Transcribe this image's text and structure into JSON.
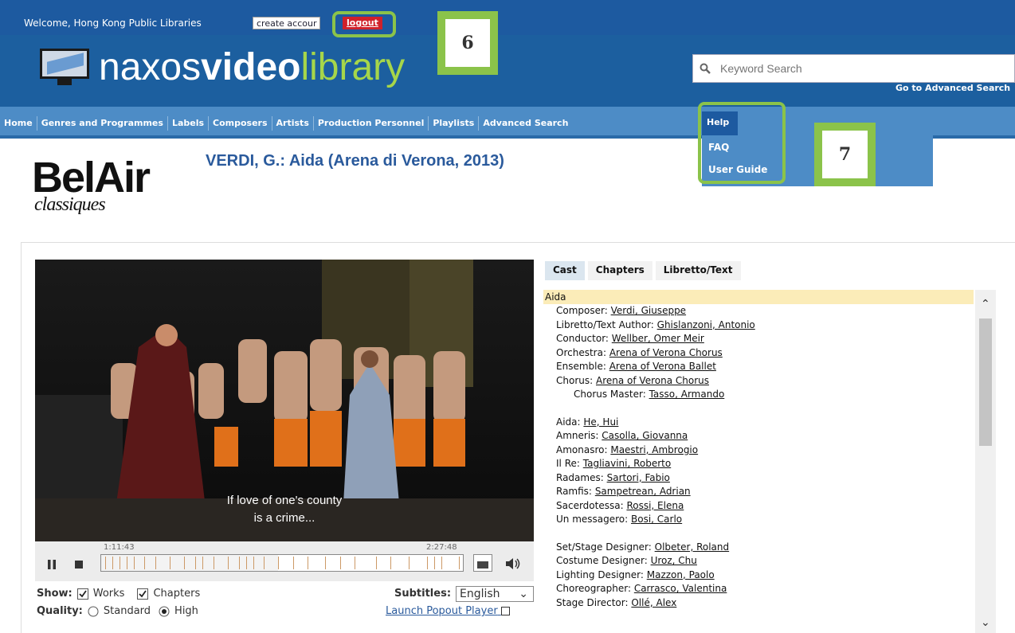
{
  "topbar": {
    "welcome": "Welcome, Hong Kong Public Libraries",
    "create_account": "create accour",
    "logout": "logout"
  },
  "header": {
    "logo_word1": "naxos",
    "logo_word2": "video",
    "logo_word3": "library",
    "search_placeholder": "Keyword Search",
    "advanced_link": "Go to Advanced Search"
  },
  "nav": {
    "items": [
      "Home",
      "Genres and Programmes",
      "Labels",
      "Composers",
      "Artists",
      "Production Personnel",
      "Playlists",
      "Advanced Search"
    ],
    "help": "Help",
    "help_menu": [
      "FAQ",
      "User Guide"
    ]
  },
  "annotations": {
    "badge_6": "6",
    "badge_7": "7"
  },
  "label_logo": {
    "main": "BelAir",
    "sub": "classiques"
  },
  "work_title": "VERDI, G.: Aida (Arena di Verona, 2013)",
  "player": {
    "subtitle_line1": "If love of one's county",
    "subtitle_line2": "is a crime...",
    "time_start": "1:11:43",
    "time_end": "2:27:48",
    "progress_fraction": 0.49
  },
  "options": {
    "show_label": "Show:",
    "works": "Works",
    "chapters": "Chapters",
    "quality_label": "Quality:",
    "standard": "Standard",
    "high": "High",
    "subtitles_label": "Subtitles:",
    "subtitles_value": "English",
    "launch_popout": "Launch Popout Player"
  },
  "tabs": [
    "Cast",
    "Chapters",
    "Libretto/Text"
  ],
  "cast": {
    "heading": "Aida",
    "credits": [
      {
        "role": "Composer:",
        "name": "Verdi, Giuseppe"
      },
      {
        "role": "Libretto/Text Author:",
        "name": "Ghislanzoni, Antonio"
      },
      {
        "role": "Conductor:",
        "name": "Wellber, Omer Meir"
      },
      {
        "role": "Orchestra:",
        "name": "Arena of Verona Chorus"
      },
      {
        "role": "Ensemble:",
        "name": "Arena of Verona Ballet"
      },
      {
        "role": "Chorus:",
        "name": "Arena of Verona Chorus"
      }
    ],
    "chorus_master": {
      "role": "Chorus Master:",
      "name": "Tasso, Armando"
    },
    "roles": [
      {
        "role": "Aida:",
        "name": "He, Hui"
      },
      {
        "role": "Amneris:",
        "name": "Casolla, Giovanna"
      },
      {
        "role": "Amonasro:",
        "name": "Maestri, Ambrogio"
      },
      {
        "role": "Il Re:",
        "name": "Tagliavini, Roberto"
      },
      {
        "role": "Radames:",
        "name": "Sartori, Fabio"
      },
      {
        "role": "Ramfis:",
        "name": "Sampetrean, Adrian"
      },
      {
        "role": "Sacerdotessa:",
        "name": "Rossi, Elena"
      },
      {
        "role": "Un messagero:",
        "name": "Bosi, Carlo"
      }
    ],
    "production": [
      {
        "role": "Set/Stage Designer:",
        "name": "Olbeter, Roland"
      },
      {
        "role": "Costume Designer:",
        "name": "Uroz, Chu"
      },
      {
        "role": "Lighting Designer:",
        "name": "Mazzon, Paolo"
      },
      {
        "role": "Choreographer:",
        "name": "Carrasco, Valentina"
      },
      {
        "role": "Stage Director:",
        "name": "Ollé, Alex"
      }
    ]
  }
}
